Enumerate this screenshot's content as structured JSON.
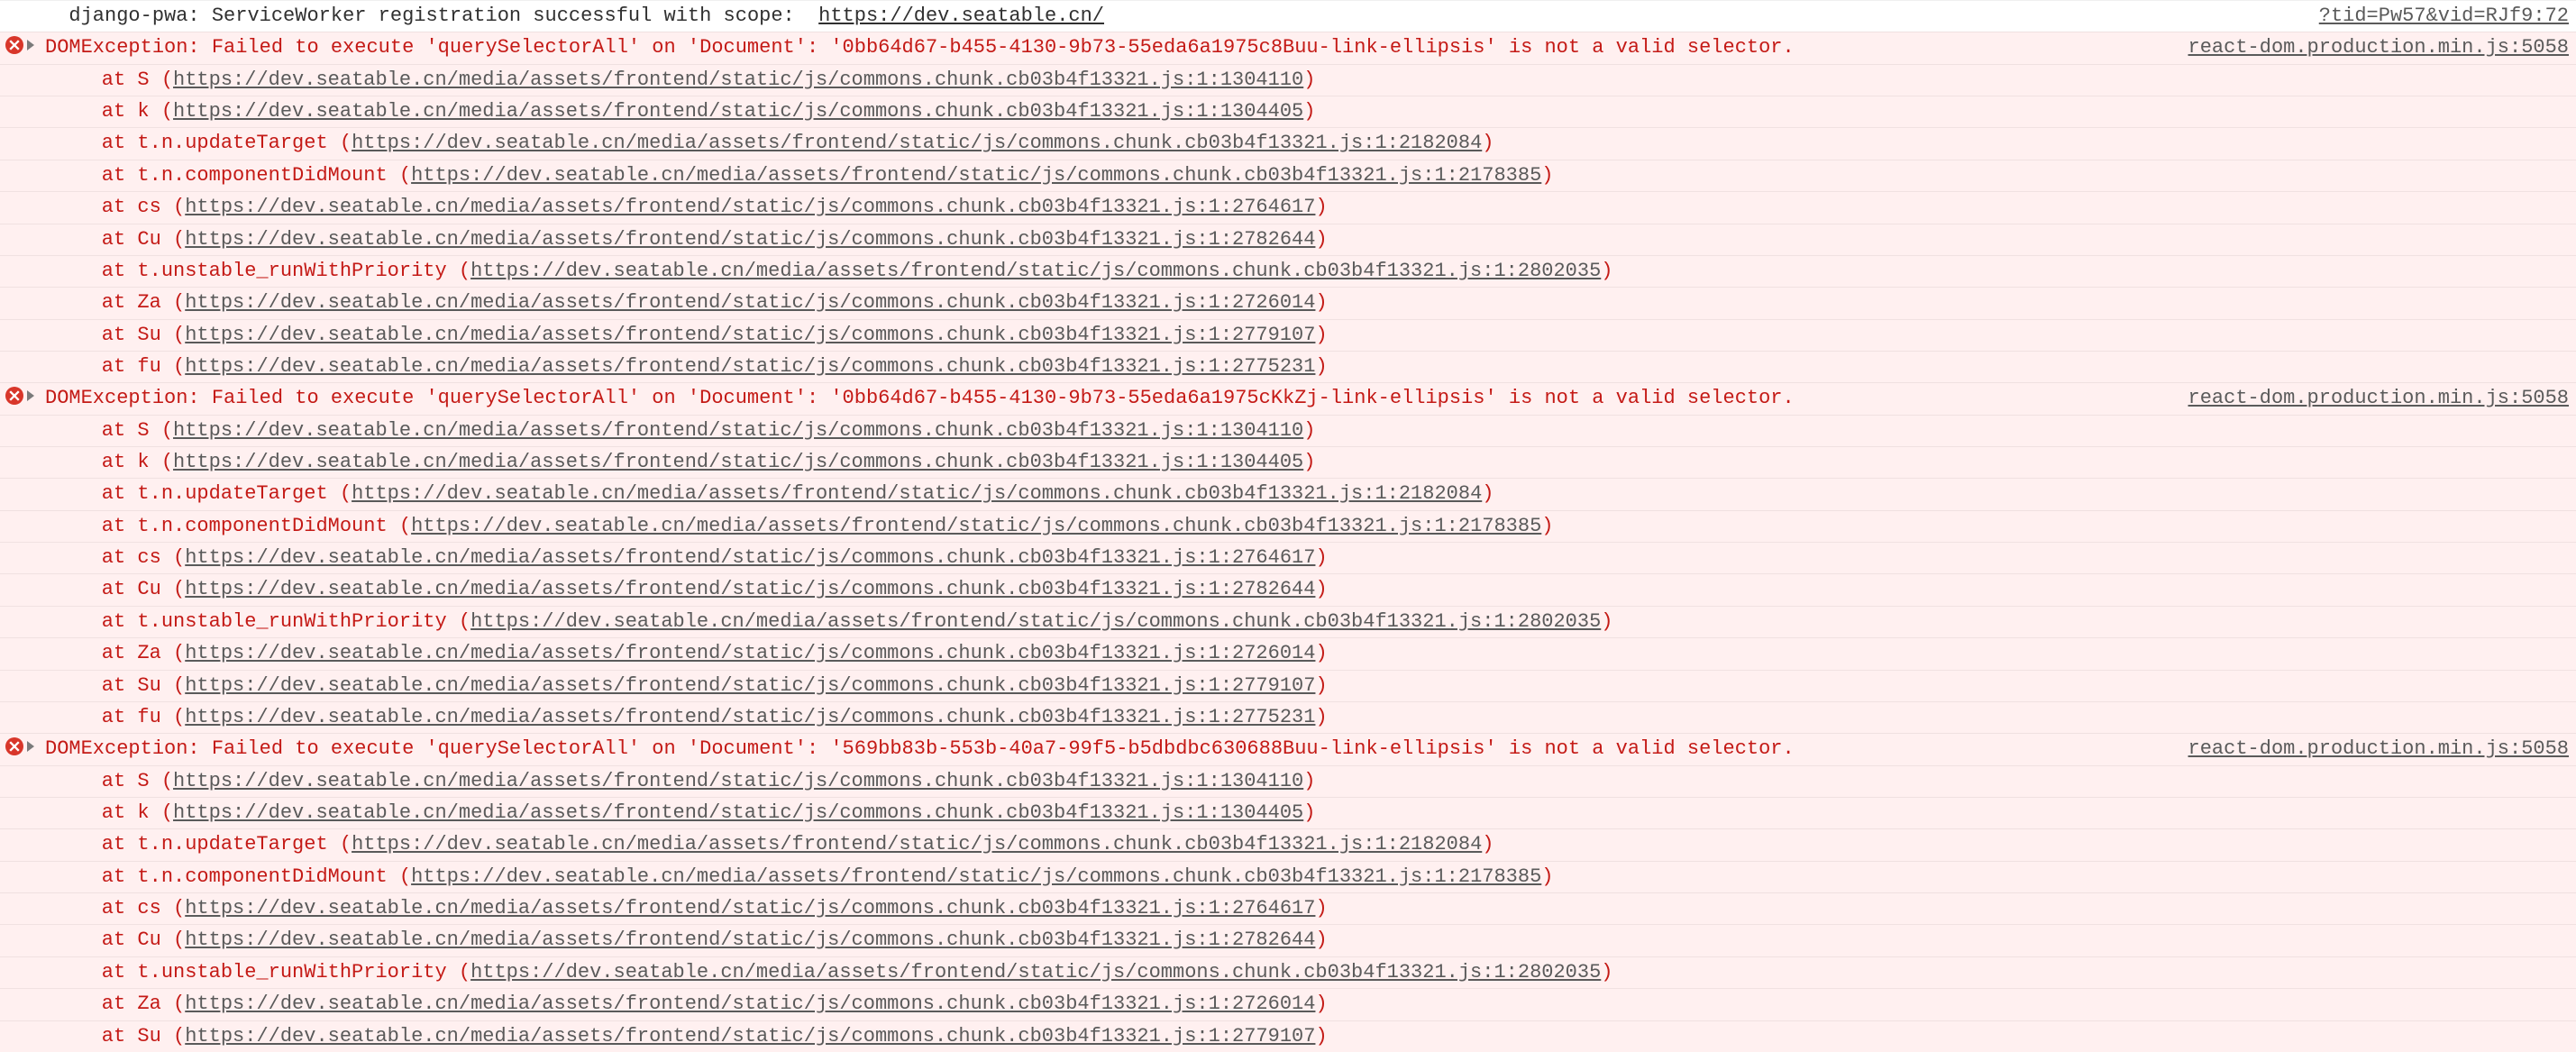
{
  "log": {
    "prefix": "  django-pwa:",
    "message": " ServiceWorker registration successful with scope:  ",
    "scope_url": "https://dev.seatable.cn/",
    "source": "?tid=Pw57&vid=RJf9:72"
  },
  "errors": [
    {
      "headline": "DOMException: Failed to execute 'querySelectorAll' on 'Document': '0bb64d67-b455-4130-9b73-55eda6a1975c8Buu-link-ellipsis' is not a valid selector.",
      "source": "react-dom.production.min.js:5058",
      "frames": [
        {
          "fn": "S",
          "loc": "https://dev.seatable.cn/media/assets/frontend/static/js/commons.chunk.cb03b4f13321.js:1:1304110"
        },
        {
          "fn": "k",
          "loc": "https://dev.seatable.cn/media/assets/frontend/static/js/commons.chunk.cb03b4f13321.js:1:1304405"
        },
        {
          "fn": "t.n.updateTarget",
          "loc": "https://dev.seatable.cn/media/assets/frontend/static/js/commons.chunk.cb03b4f13321.js:1:2182084"
        },
        {
          "fn": "t.n.componentDidMount",
          "loc": "https://dev.seatable.cn/media/assets/frontend/static/js/commons.chunk.cb03b4f13321.js:1:2178385"
        },
        {
          "fn": "cs",
          "loc": "https://dev.seatable.cn/media/assets/frontend/static/js/commons.chunk.cb03b4f13321.js:1:2764617"
        },
        {
          "fn": "Cu",
          "loc": "https://dev.seatable.cn/media/assets/frontend/static/js/commons.chunk.cb03b4f13321.js:1:2782644"
        },
        {
          "fn": "t.unstable_runWithPriority",
          "loc": "https://dev.seatable.cn/media/assets/frontend/static/js/commons.chunk.cb03b4f13321.js:1:2802035"
        },
        {
          "fn": "Za",
          "loc": "https://dev.seatable.cn/media/assets/frontend/static/js/commons.chunk.cb03b4f13321.js:1:2726014"
        },
        {
          "fn": "Su",
          "loc": "https://dev.seatable.cn/media/assets/frontend/static/js/commons.chunk.cb03b4f13321.js:1:2779107"
        },
        {
          "fn": "fu",
          "loc": "https://dev.seatable.cn/media/assets/frontend/static/js/commons.chunk.cb03b4f13321.js:1:2775231"
        }
      ]
    },
    {
      "headline": "DOMException: Failed to execute 'querySelectorAll' on 'Document': '0bb64d67-b455-4130-9b73-55eda6a1975cKkZj-link-ellipsis' is not a valid selector.",
      "source": "react-dom.production.min.js:5058",
      "frames": [
        {
          "fn": "S",
          "loc": "https://dev.seatable.cn/media/assets/frontend/static/js/commons.chunk.cb03b4f13321.js:1:1304110"
        },
        {
          "fn": "k",
          "loc": "https://dev.seatable.cn/media/assets/frontend/static/js/commons.chunk.cb03b4f13321.js:1:1304405"
        },
        {
          "fn": "t.n.updateTarget",
          "loc": "https://dev.seatable.cn/media/assets/frontend/static/js/commons.chunk.cb03b4f13321.js:1:2182084"
        },
        {
          "fn": "t.n.componentDidMount",
          "loc": "https://dev.seatable.cn/media/assets/frontend/static/js/commons.chunk.cb03b4f13321.js:1:2178385"
        },
        {
          "fn": "cs",
          "loc": "https://dev.seatable.cn/media/assets/frontend/static/js/commons.chunk.cb03b4f13321.js:1:2764617"
        },
        {
          "fn": "Cu",
          "loc": "https://dev.seatable.cn/media/assets/frontend/static/js/commons.chunk.cb03b4f13321.js:1:2782644"
        },
        {
          "fn": "t.unstable_runWithPriority",
          "loc": "https://dev.seatable.cn/media/assets/frontend/static/js/commons.chunk.cb03b4f13321.js:1:2802035"
        },
        {
          "fn": "Za",
          "loc": "https://dev.seatable.cn/media/assets/frontend/static/js/commons.chunk.cb03b4f13321.js:1:2726014"
        },
        {
          "fn": "Su",
          "loc": "https://dev.seatable.cn/media/assets/frontend/static/js/commons.chunk.cb03b4f13321.js:1:2779107"
        },
        {
          "fn": "fu",
          "loc": "https://dev.seatable.cn/media/assets/frontend/static/js/commons.chunk.cb03b4f13321.js:1:2775231"
        }
      ]
    },
    {
      "headline": "DOMException: Failed to execute 'querySelectorAll' on 'Document': '569bb83b-553b-40a7-99f5-b5dbdbc630688Buu-link-ellipsis' is not a valid selector.",
      "source": "react-dom.production.min.js:5058",
      "frames": [
        {
          "fn": "S",
          "loc": "https://dev.seatable.cn/media/assets/frontend/static/js/commons.chunk.cb03b4f13321.js:1:1304110"
        },
        {
          "fn": "k",
          "loc": "https://dev.seatable.cn/media/assets/frontend/static/js/commons.chunk.cb03b4f13321.js:1:1304405"
        },
        {
          "fn": "t.n.updateTarget",
          "loc": "https://dev.seatable.cn/media/assets/frontend/static/js/commons.chunk.cb03b4f13321.js:1:2182084"
        },
        {
          "fn": "t.n.componentDidMount",
          "loc": "https://dev.seatable.cn/media/assets/frontend/static/js/commons.chunk.cb03b4f13321.js:1:2178385"
        },
        {
          "fn": "cs",
          "loc": "https://dev.seatable.cn/media/assets/frontend/static/js/commons.chunk.cb03b4f13321.js:1:2764617"
        },
        {
          "fn": "Cu",
          "loc": "https://dev.seatable.cn/media/assets/frontend/static/js/commons.chunk.cb03b4f13321.js:1:2782644"
        },
        {
          "fn": "t.unstable_runWithPriority",
          "loc": "https://dev.seatable.cn/media/assets/frontend/static/js/commons.chunk.cb03b4f13321.js:1:2802035"
        },
        {
          "fn": "Za",
          "loc": "https://dev.seatable.cn/media/assets/frontend/static/js/commons.chunk.cb03b4f13321.js:1:2726014"
        },
        {
          "fn": "Su",
          "loc": "https://dev.seatable.cn/media/assets/frontend/static/js/commons.chunk.cb03b4f13321.js:1:2779107"
        }
      ]
    }
  ]
}
